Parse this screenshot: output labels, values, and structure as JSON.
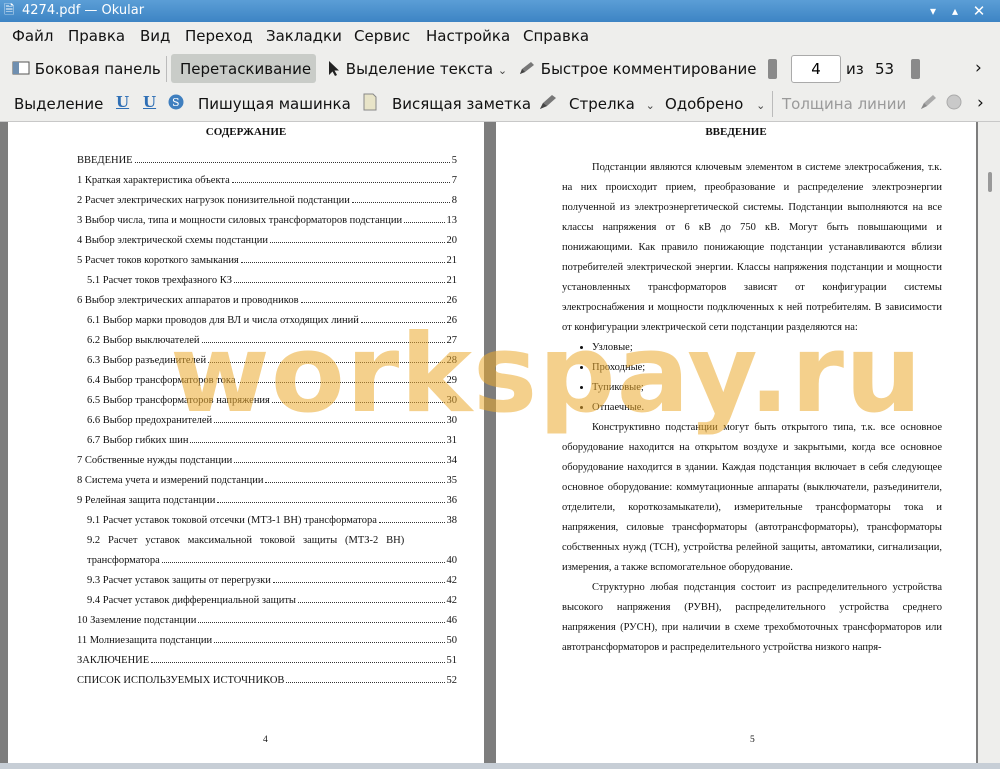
{
  "window": {
    "title": "4274.pdf — Okular"
  },
  "menu": [
    "Файл",
    "Правка",
    "Вид",
    "Переход",
    "Закладки",
    "Сервис",
    "Настройка",
    "Справка"
  ],
  "toolbar": {
    "sidebar": "Боковая панель",
    "drag": "Перетаскивание",
    "text_select": "Выделение текста",
    "quick_comment": "Быстрое комментирование",
    "page_current": "4",
    "page_of": "из",
    "page_total": "53"
  },
  "annot_toolbar": {
    "selection": "Выделение",
    "typewriter": "Пишущая машинка",
    "note": "Висящая заметка",
    "arrow": "Стрелка",
    "stamp": "Одобрено",
    "line_width": "Толщина линии"
  },
  "left_page": {
    "title": "СОДЕРЖАНИЕ",
    "page_number": "4",
    "toc": [
      {
        "text": "ВВЕДЕНИЕ",
        "page": "5"
      },
      {
        "text": "1 Краткая характеристика объекта",
        "page": "7"
      },
      {
        "text": "2 Расчет электрических нагрузок понизительной подстанции",
        "page": "8"
      },
      {
        "text": "3 Выбор числа, типа и мощности силовых трансформаторов подстанции",
        "page": "13"
      },
      {
        "text": "4 Выбор электрической схемы подстанции",
        "page": "20"
      },
      {
        "text": "5 Расчет токов короткого замыкания",
        "page": "21"
      },
      {
        "text": "5.1 Расчет токов трехфазного КЗ",
        "page": "21"
      },
      {
        "text": "6 Выбор электрических аппаратов и проводников",
        "page": "26"
      },
      {
        "text": "6.1 Выбор марки проводов для ВЛ и числа отходящих линий",
        "page": "26"
      },
      {
        "text": "6.2 Выбор выключателей",
        "page": "27"
      },
      {
        "text": "6.3 Выбор разъединителей",
        "page": "28"
      },
      {
        "text": "6.4 Выбор трансформаторов тока",
        "page": "29"
      },
      {
        "text": "6.5 Выбор трансформаторов напряжения",
        "page": "30"
      },
      {
        "text": "6.6 Выбор предохранителей",
        "page": "30"
      },
      {
        "text": "6.7 Выбор гибких шин",
        "page": "31"
      },
      {
        "text": "7 Собственные нужды подстанции",
        "page": "34"
      },
      {
        "text": "8 Система учета и измерений подстанции",
        "page": "35"
      },
      {
        "text": "9 Релейная защита подстанции",
        "page": "36"
      },
      {
        "text": "9.1 Расчет уставок токовой отсечки (МТЗ-1 ВН) трансформатора",
        "page": "38"
      },
      {
        "text": "9.2   Расчет   уставок   максимальной   токовой   защиты   (МТЗ-2   ВН)",
        "page": ""
      },
      {
        "text": "трансформатора",
        "page": "40"
      },
      {
        "text": "9.3 Расчет уставок защиты от перегрузки",
        "page": "42"
      },
      {
        "text": "9.4 Расчет уставок дифференциальной защиты",
        "page": "42"
      },
      {
        "text": "10 Заземление подстанции",
        "page": "46"
      },
      {
        "text": "11 Молниезащита подстанции",
        "page": "50"
      },
      {
        "text": "ЗАКЛЮЧЕНИЕ",
        "page": "51"
      },
      {
        "text": "СПИСОК ИСПОЛЬЗУЕМЫХ ИСТОЧНИКОВ",
        "page": "52"
      }
    ]
  },
  "right_page": {
    "title": "ВВЕДЕНИЕ",
    "page_number": "5",
    "p1": "Подстанции являются ключевым элементом в системе электросабжения, т.к. на них происходит прием, преобразование и распределение электроэнергии полученной из электроэнергетической системы. Подстанции выполняются на все классы напряжения от 6 кВ до 750 кВ. Могут быть повышающими и понижающими. Как правило понижающие подстанции устанавливаются вблизи потребителей электрической энергии. Классы напряжения подстанции и мощности установленных трансформаторов зависят от конфигурации системы электроснабжения и мощности подключенных к ней потребителям. В зависимости от конфигурации электрической сети подстанции разделяются на:",
    "list": [
      "Узловые;",
      "Проходные;",
      "Тупиковые;",
      "Отпаечные."
    ],
    "p2": "Конструктивно подстанции могут быть открытого типа, т.к. все основное оборудование находится на открытом воздухе и закрытыми, когда все основное оборудование находится в здании. Каждая подстанция включает в себя следующее основное оборудование: коммутационные аппараты (выключатели, разъединители, отделители, короткозамыкатели), измерительные трансформаторы тока и напряжения, силовые трансформаторы (автотрансформаторы), трансформаторы собственных нужд (ТСН), устройства релейной защиты, автоматики, сигнализации, измерения, а также вспомогательное оборудование.",
    "p3": "Структурно любая подстанция состоит из распределительного устройства высокого напряжения (РУВН), распределительного устройства среднего напряжения (РУСН), при наличии в схеме трехобмоточных трансформаторов или автотрансформаторов и распределительного устройства низкого напря-"
  },
  "watermark": "workspay.ru"
}
